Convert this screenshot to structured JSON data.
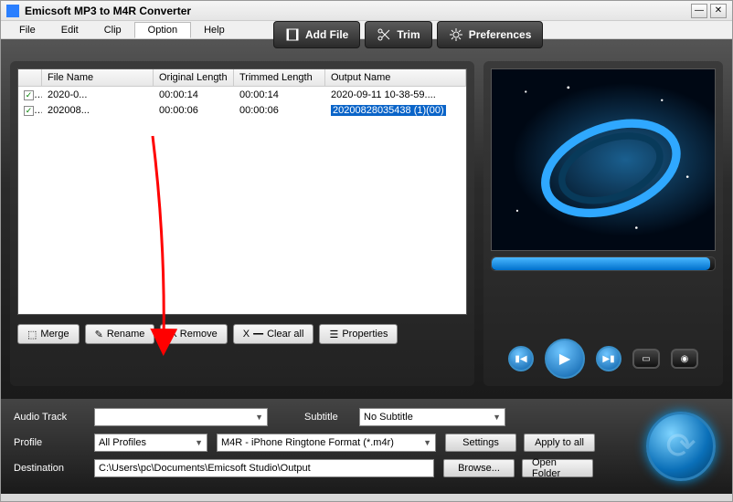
{
  "app": {
    "title": "Emicsoft MP3 to M4R Converter"
  },
  "menubar": {
    "file": "File",
    "edit": "Edit",
    "clip": "Clip",
    "option": "Option",
    "help": "Help"
  },
  "toolbar": {
    "add_file": "Add File",
    "trim": "Trim",
    "preferences": "Preferences"
  },
  "columns": {
    "file_name": "File Name",
    "original_length": "Original Length",
    "trimmed_length": "Trimmed Length",
    "output_name": "Output Name"
  },
  "files": [
    {
      "name": "2020-0...",
      "orig": "00:00:14",
      "trim": "00:00:14",
      "output": "2020-09-11 10-38-59....",
      "selected": false
    },
    {
      "name": "202008...",
      "orig": "00:00:06",
      "trim": "00:00:06",
      "output": "20200828035438 (1)(00)",
      "selected": true
    }
  ],
  "list_buttons": {
    "merge": "Merge",
    "rename": "Rename",
    "remove": "X Remove",
    "clear_all": "Clear all",
    "properties": "Properties"
  },
  "bottom": {
    "audio_track_label": "Audio Track",
    "audio_track_value": "",
    "subtitle_label": "Subtitle",
    "subtitle_value": "No Subtitle",
    "profile_label": "Profile",
    "profile_category": "All Profiles",
    "profile_format": "M4R - iPhone Ringtone Format (*.m4r)",
    "settings": "Settings",
    "apply_to_all": "Apply to all",
    "destination_label": "Destination",
    "destination_path": "C:\\Users\\pc\\Documents\\Emicsoft Studio\\Output",
    "browse": "Browse...",
    "open_folder": "Open Folder"
  },
  "clear_all_prefix": "X"
}
